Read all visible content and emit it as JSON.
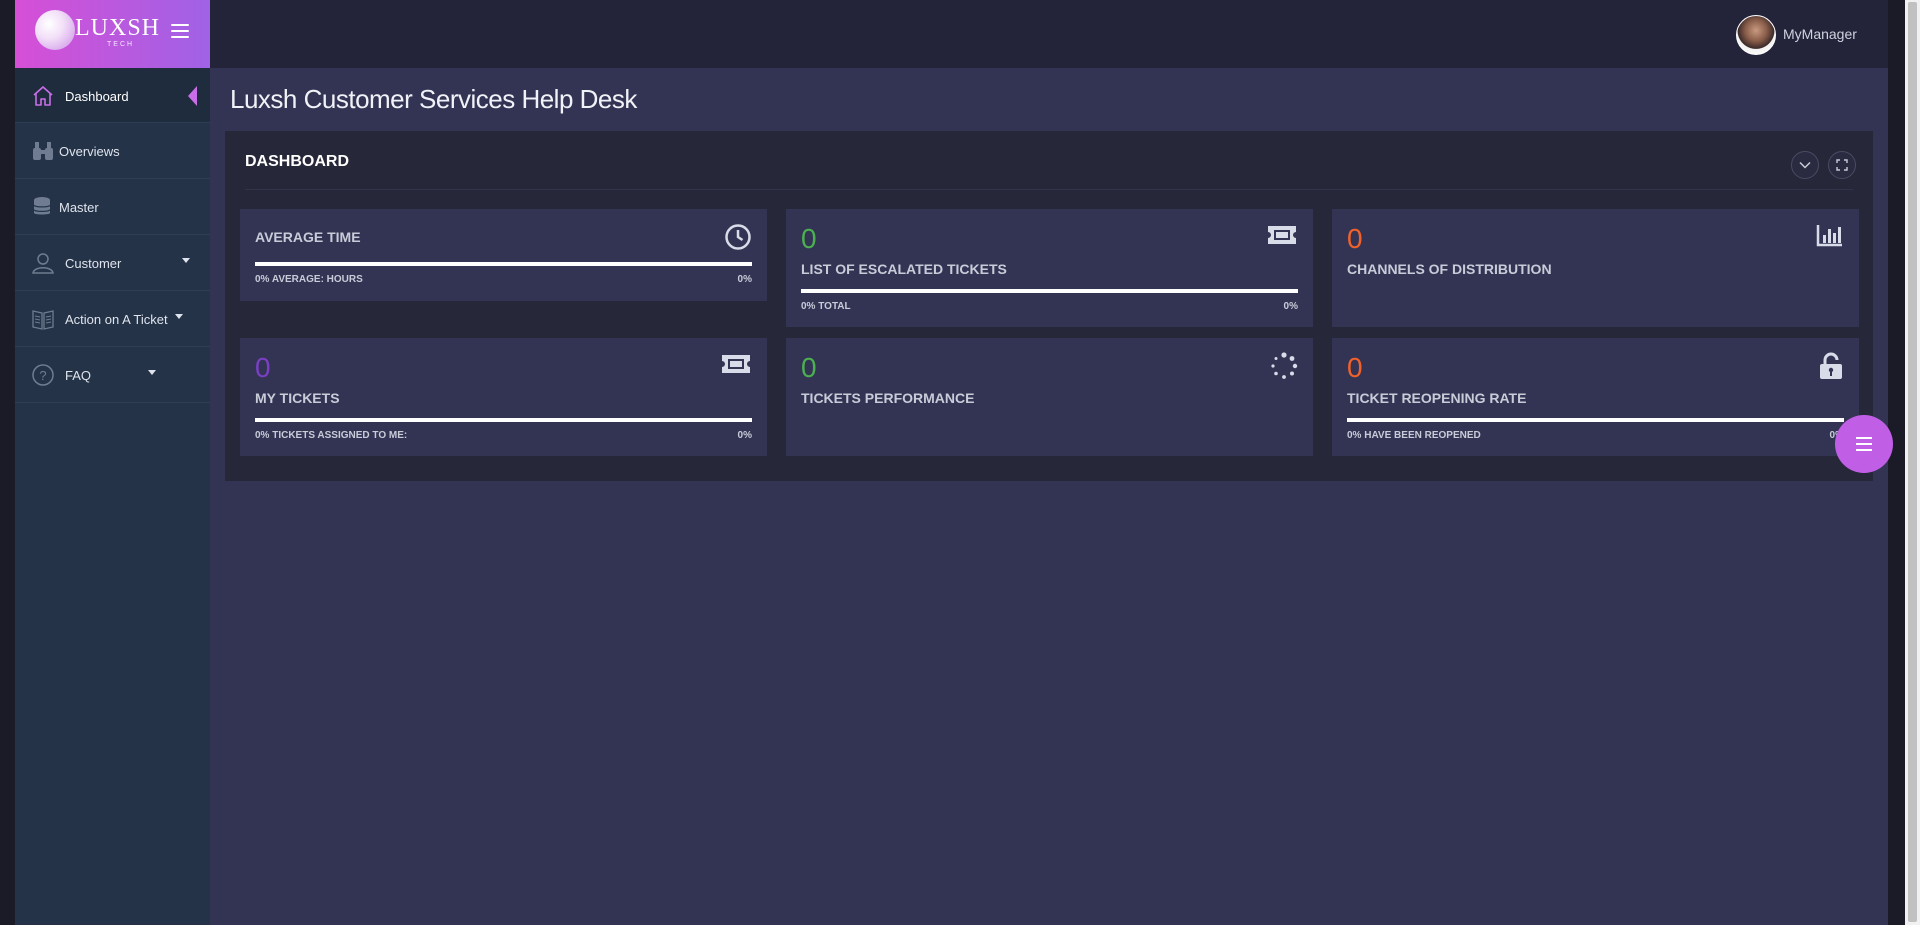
{
  "brand": {
    "name": "LUXSH",
    "sub": "TECH",
    "colors": {
      "gradient_start": "#d64fd6",
      "gradient_end": "#a062e6"
    }
  },
  "sidebar": {
    "items": [
      {
        "label": "Dashboard",
        "icon": "home-icon",
        "active": true
      },
      {
        "label": "Overviews",
        "icon": "binoculars-icon"
      },
      {
        "label": "Master",
        "icon": "database-icon"
      },
      {
        "label": "Customer",
        "icon": "user-icon",
        "has_submenu": true
      },
      {
        "label": "Action on A Ticket",
        "icon": "book-icon",
        "has_submenu": true
      },
      {
        "label": "FAQ",
        "icon": "question-circle-icon",
        "has_submenu": true
      }
    ]
  },
  "topbar": {
    "username": "MyManager"
  },
  "page": {
    "title": "Luxsh Customer Services Help Desk"
  },
  "panel": {
    "title": "DASHBOARD"
  },
  "cards": {
    "average_time": {
      "label": "AVERAGE TIME",
      "sub_left": "0% AVERAGE: HOURS",
      "sub_right": "0%",
      "icon": "clock-icon"
    },
    "escalated": {
      "value": "0",
      "label": "LIST OF ESCALATED TICKETS",
      "sub_left": "0% TOTAL",
      "sub_right": "0%",
      "icon": "ticket-icon",
      "value_color": "#4caf50"
    },
    "channels": {
      "value": "0",
      "label": "CHANNELS OF DISTRIBUTION",
      "icon": "bar-chart-icon",
      "value_color": "#f0612b"
    },
    "my_tickets": {
      "value": "0",
      "label": "MY TICKETS",
      "sub_left": "0% TICKETS ASSIGNED TO ME:",
      "sub_right": "0%",
      "icon": "ticket-icon",
      "value_color": "#7a3fc4"
    },
    "performance": {
      "value": "0",
      "label": "TICKETS PERFORMANCE",
      "icon": "spinner-icon",
      "value_color": "#4caf50"
    },
    "reopening": {
      "value": "0",
      "label": "TICKET REOPENING RATE",
      "sub_left": "0% HAVE BEEN REOPENED",
      "sub_right": "0%",
      "icon": "unlock-icon",
      "value_color": "#f0612b"
    }
  },
  "fab": {
    "icon": "menu-icon",
    "color": "#c05fe6"
  }
}
